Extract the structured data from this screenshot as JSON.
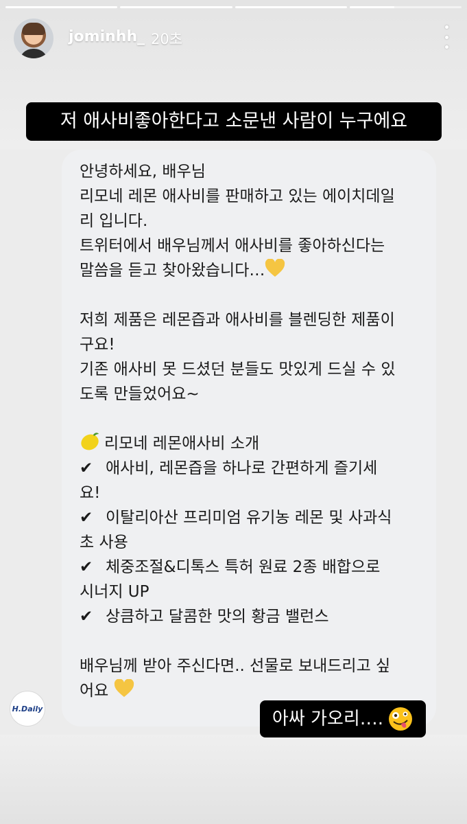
{
  "story": {
    "progress_segments": [
      1,
      1,
      1,
      0.4
    ],
    "username": "jominhh_",
    "timestamp": "20초",
    "more_icon": "more-vertical-icon"
  },
  "caption_top": "저 애사비좋아한다고 소문낸 사람이 누구에요",
  "message": {
    "line1": "안녕하세요, 배우님",
    "line2": "리모네 레몬 애사비를 판매하고 있는 에이치데일",
    "line3": "리 입니다.",
    "line4": "트위터에서 배우님께서 애사비를 좋아하신다는",
    "line5": "말씀을 듣고 찾아왔습니다…",
    "line6": "저희 제품은 레몬즙과 애사비를 블렌딩한 제품이",
    "line7": "구요!",
    "line8": "기존 애사비 못 드셨던 분들도 맛있게 드실 수 있",
    "line9": "도록 만들었어요~",
    "intro": "리모네 레몬애사비 소개",
    "check_mark": "✔",
    "point1a": "애사비, 레몬즙을 하나로 간편하게 즐기세",
    "point1b": "요!",
    "point2a": "이탈리아산 프리미엄 유기농 레몬 및 사과식",
    "point2b": "초 사용",
    "point3a": "체중조절&디톡스 특허 원료 2종 배합으로",
    "point3b": "시너지 UP",
    "point4": "상큼하고 달콤한 맛의 황금 밸런스",
    "closing1": "배우님께 받아 주신다면.. 선물로 보내드리고 싶",
    "closing2": "어요"
  },
  "sender_logo": "H.Daily",
  "caption_bottom": "아싸 가오리….",
  "colors": {
    "caption_bg": "#000000",
    "bubble_bg": "#eff0f2",
    "heart": "#f5c542",
    "lemon": "#f2d21b"
  }
}
